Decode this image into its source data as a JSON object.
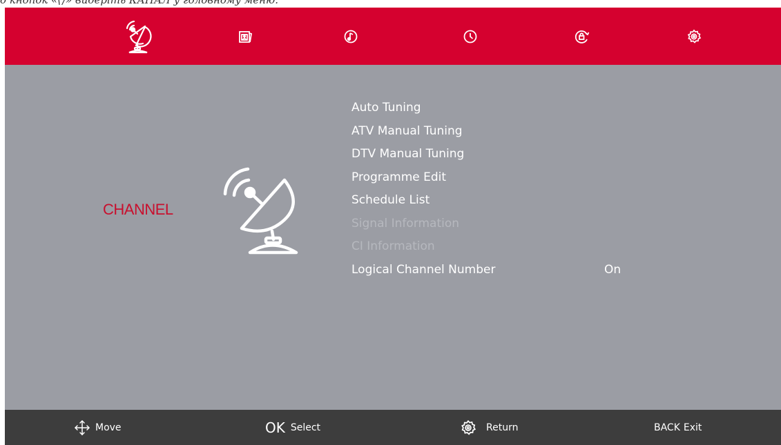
{
  "caption": "о кнопок «⟨⟩» виберіть КАНАЛ у головному меню.",
  "tabs": [
    {
      "icon": "satellite-dish-icon",
      "selected": true
    },
    {
      "icon": "picture-icon",
      "selected": false
    },
    {
      "icon": "sound-icon",
      "selected": false
    },
    {
      "icon": "clock-icon",
      "selected": false
    },
    {
      "icon": "lock-icon",
      "selected": false
    },
    {
      "icon": "settings-icon",
      "selected": false
    }
  ],
  "section_title": "CHANNEL",
  "menu": {
    "items": [
      {
        "label": "Auto Tuning",
        "enabled": true,
        "value": ""
      },
      {
        "label": "ATV Manual Tuning",
        "enabled": true,
        "value": ""
      },
      {
        "label": "DTV Manual Tuning",
        "enabled": true,
        "value": ""
      },
      {
        "label": "Programme Edit",
        "enabled": true,
        "value": ""
      },
      {
        "label": "Schedule List",
        "enabled": true,
        "value": ""
      },
      {
        "label": "Signal Information",
        "enabled": false,
        "value": ""
      },
      {
        "label": "CI Information",
        "enabled": false,
        "value": ""
      },
      {
        "label": "Logical Channel Number",
        "enabled": true,
        "value": "On"
      }
    ]
  },
  "hints": {
    "move": {
      "key": "",
      "label": "Move"
    },
    "select": {
      "key": "OK",
      "label": "Select"
    },
    "return": {
      "key": "",
      "label": "Return"
    },
    "exit": {
      "key": "BACK",
      "label": "Exit"
    }
  },
  "colors": {
    "topbar": "#d5012f",
    "panel": "#9b9da4",
    "bottombar": "#3d3d3d",
    "accent": "#c8102e"
  }
}
